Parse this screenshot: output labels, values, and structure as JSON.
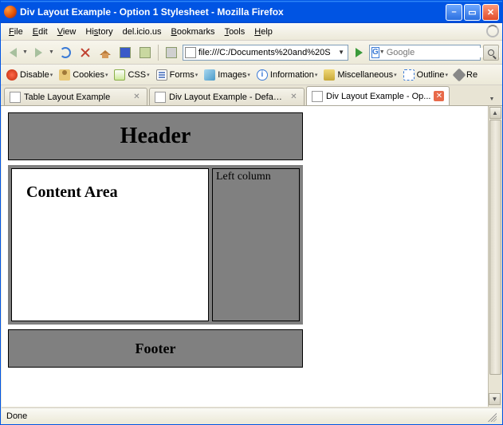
{
  "window": {
    "title": "Div Layout Example - Option 1 Stylesheet - Mozilla Firefox"
  },
  "menu": {
    "file": "File",
    "edit": "Edit",
    "view": "View",
    "history": "History",
    "delicious": "del.icio.us",
    "bookmarks": "Bookmarks",
    "tools": "Tools",
    "help": "Help"
  },
  "urlbar": {
    "value": "file:///C:/Documents%20and%20S"
  },
  "search": {
    "engine_letter": "G",
    "placeholder": "Google"
  },
  "devbar": {
    "disable": "Disable",
    "cookies": "Cookies",
    "css": "CSS",
    "forms": "Forms",
    "images": "Images",
    "information": "Information",
    "miscellaneous": "Miscellaneous",
    "outline": "Outline",
    "resize": "Re"
  },
  "tabs": [
    {
      "label": "Table Layout Example",
      "active": false
    },
    {
      "label": "Div Layout Example - Defau...",
      "active": false
    },
    {
      "label": "Div Layout Example - Op...",
      "active": true
    }
  ],
  "page": {
    "header": "Header",
    "content": "Content Area",
    "left": "Left column",
    "footer": "Footer"
  },
  "status": {
    "text": "Done"
  }
}
